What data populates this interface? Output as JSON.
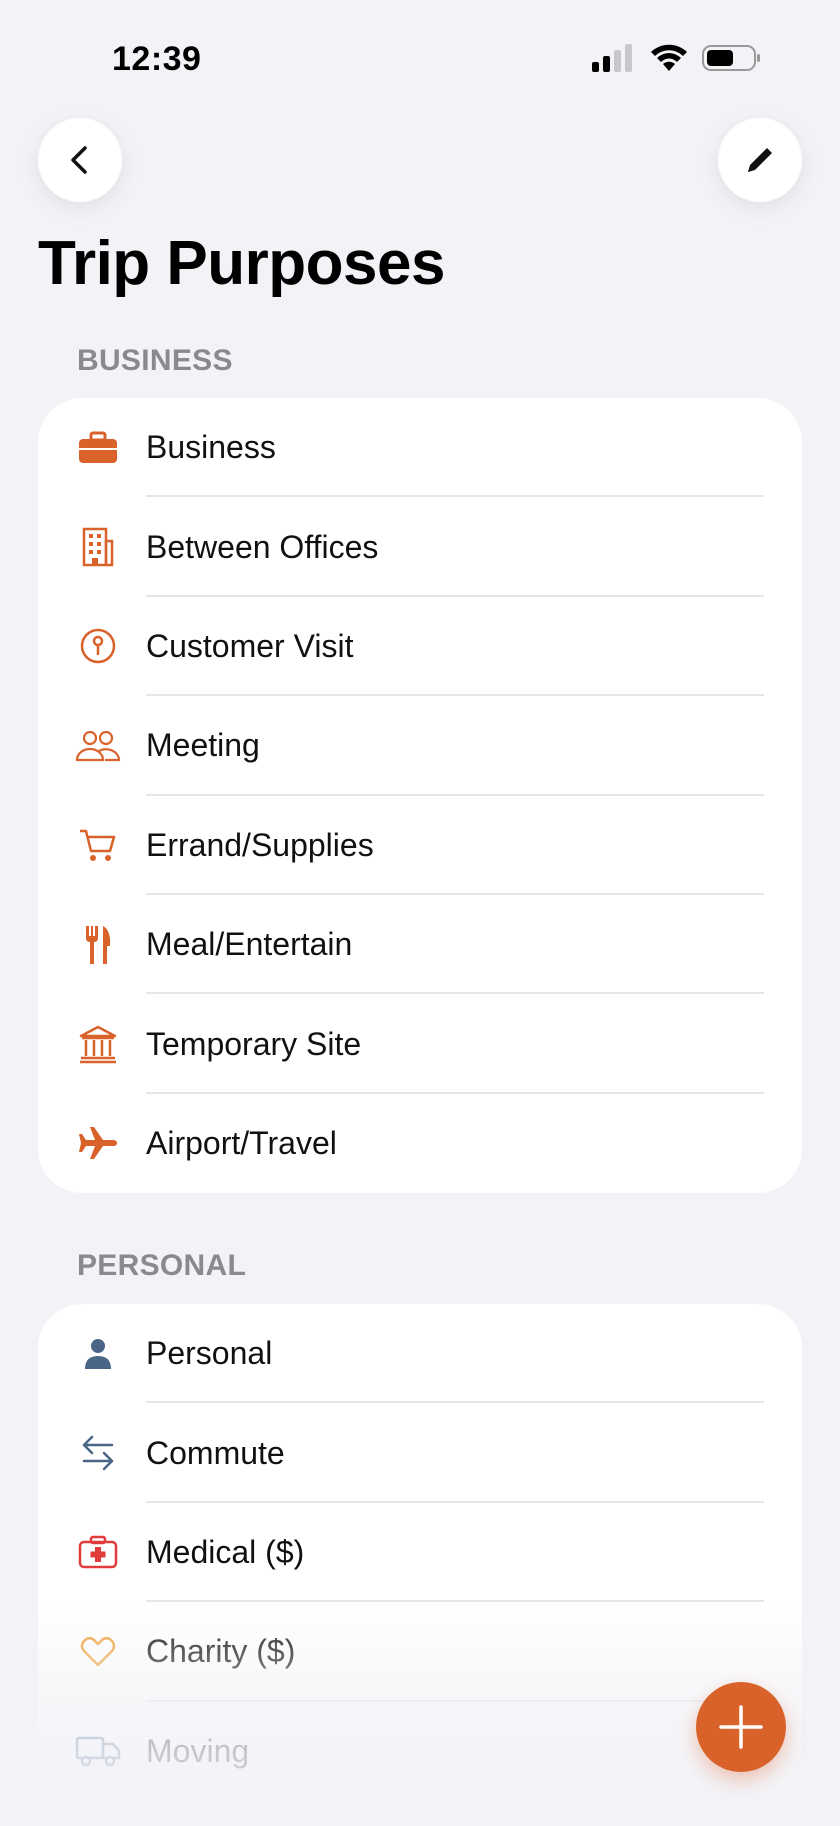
{
  "status_bar": {
    "time": "12:39"
  },
  "nav": {
    "back": "back",
    "edit": "edit"
  },
  "page_title": "Trip Purposes",
  "colors": {
    "accent": "#d9622b",
    "personal": "#4a6585",
    "medical": "#e23b3b",
    "charity": "#f2a23a"
  },
  "sections": [
    {
      "header": "BUSINESS",
      "items": [
        {
          "label": "Business",
          "icon": "briefcase-icon"
        },
        {
          "label": "Between Offices",
          "icon": "building-icon"
        },
        {
          "label": "Customer Visit",
          "icon": "location-pin-icon"
        },
        {
          "label": "Meeting",
          "icon": "people-icon"
        },
        {
          "label": "Errand/Supplies",
          "icon": "cart-icon"
        },
        {
          "label": "Meal/Entertain",
          "icon": "fork-knife-icon"
        },
        {
          "label": "Temporary Site",
          "icon": "bank-icon"
        },
        {
          "label": "Airport/Travel",
          "icon": "airplane-icon"
        }
      ]
    },
    {
      "header": "PERSONAL",
      "items": [
        {
          "label": "Personal",
          "icon": "person-icon"
        },
        {
          "label": "Commute",
          "icon": "arrows-left-right-icon"
        },
        {
          "label": "Medical ($)",
          "icon": "medical-kit-icon"
        },
        {
          "label": "Charity ($)",
          "icon": "heart-icon"
        },
        {
          "label": "Moving",
          "icon": "truck-icon"
        }
      ]
    }
  ]
}
